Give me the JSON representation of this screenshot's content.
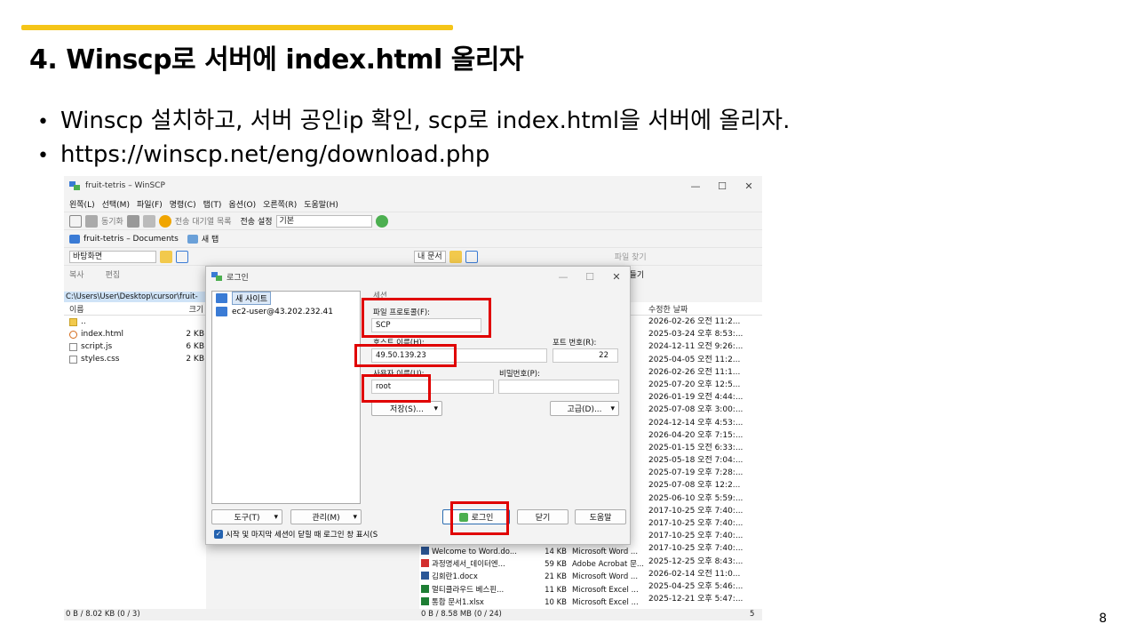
{
  "slide": {
    "title": "4. Winscp로 서버에 index.html 올리자",
    "bullets": [
      "Winscp 설치하고, 서버 공인ip 확인, scp로 index.html을 서버에 올리자.",
      "https://winscp.net/eng/download.php"
    ],
    "page_number": "8"
  },
  "winscp": {
    "title": "fruit-tetris – WinSCP",
    "menu": [
      "왼쪽(L)",
      "선택(M)",
      "파일(F)",
      "명령(C)",
      "탭(T)",
      "옵션(O)",
      "오른쪽(R)",
      "도움말(H)"
    ],
    "toolbar1": {
      "sync": "동기화",
      "queue": "전송 대기열 목록",
      "transfer_settings_label": "전송 설정",
      "transfer_settings_value": "기본"
    },
    "session_tab": "fruit-tetris – Documents",
    "new_tab": "새 탭",
    "left_location": "바탕화면",
    "right_location": "내 문서",
    "find_files": "파일 찾기",
    "copy_label": "복사",
    "edit_label": "편집",
    "create_label": "로 만들기",
    "left_path": "C:\\Users\\User\\Desktop\\cursor\\fruit-",
    "left_headers": {
      "name": "이름",
      "size": "크기"
    },
    "left_files": [
      {
        "name": "..",
        "size": ""
      },
      {
        "name": "index.html",
        "size": "2 KB"
      },
      {
        "name": "script.js",
        "size": "6 KB"
      },
      {
        "name": "styles.css",
        "size": "2 KB"
      }
    ],
    "right_header_modified": "수정한 날짜",
    "right_dates": [
      "2026-02-26 오전 11:2...",
      "2025-03-24 오후 8:53:...",
      "2024-12-11 오전 9:26:...",
      "2025-04-05 오전 11:2...",
      "2026-02-26 오전 11:1...",
      "2025-07-20 오후 12:5...",
      "2026-01-19 오전 4:44:...",
      "2025-07-08 오후 3:00:...",
      "2024-12-14 오후 4:53:...",
      "2026-04-20 오후 7:15:...",
      "2025-01-15 오전 6:33:...",
      "2025-05-18 오전 7:04:...",
      "2025-07-19 오후 7:28:...",
      "2025-07-08 오후 12:2...",
      "2025-06-10 오후 5:59:...",
      "2017-10-25 오후 7:40:...",
      "2017-10-25 오후 7:40:...",
      "2017-10-25 오후 7:40:...",
      "2017-10-25 오후 7:40:...",
      "2025-12-25 오후 8:43:...",
      "2026-02-14 오전 11:0...",
      "2025-04-25 오후 5:46:...",
      "2025-12-21 오후 5:47:..."
    ],
    "right_files": [
      {
        "name": "Welcome to Word.do...",
        "size": "14 KB",
        "type": "Microsoft Word ..."
      },
      {
        "name": "과정명세서_데이터엔...",
        "size": "59 KB",
        "type": "Adobe Acrobat 문..."
      },
      {
        "name": "김회란1.docx",
        "size": "21 KB",
        "type": "Microsoft Word ..."
      },
      {
        "name": "멀티클라우드 베스핀...",
        "size": "11 KB",
        "type": "Microsoft Excel ..."
      },
      {
        "name": "통합 문서1.xlsx",
        "size": "10 KB",
        "type": "Microsoft Excel ..."
      }
    ],
    "status_left": "0 B / 8.02 KB (0 / 3)",
    "status_right": "0 B / 8.58 MB (0 / 24)",
    "status_far": "5 숨"
  },
  "login": {
    "title": "로그인",
    "new_site": "새 사이트",
    "saved_site": "ec2-user@43.202.232.41",
    "session_group": "세션",
    "protocol_label": "파일 프로토콜(F):",
    "protocol_value": "SCP",
    "host_label": "호스트 이름(H):",
    "host_value": "49.50.139.23",
    "port_label": "포트 번호(R):",
    "port_value": "22",
    "user_label": "사용자 이름(U):",
    "user_value": "root",
    "password_label": "비밀번호(P):",
    "password_value": "",
    "save_button": "저장(S)...",
    "advanced_button": "고급(D)...",
    "tools_button": "도구(T)",
    "manage_button": "관리(M)",
    "login_button": "로그인",
    "close_button": "닫기",
    "help_button": "도움말",
    "checkbox_label": "시작 및 마지막 세션이 닫힐 때 로그인 창 표시(S"
  },
  "colors": {
    "accent_bar": "#f5c518",
    "highlight_box": "#e00000",
    "selection": "#cfe3f7"
  }
}
